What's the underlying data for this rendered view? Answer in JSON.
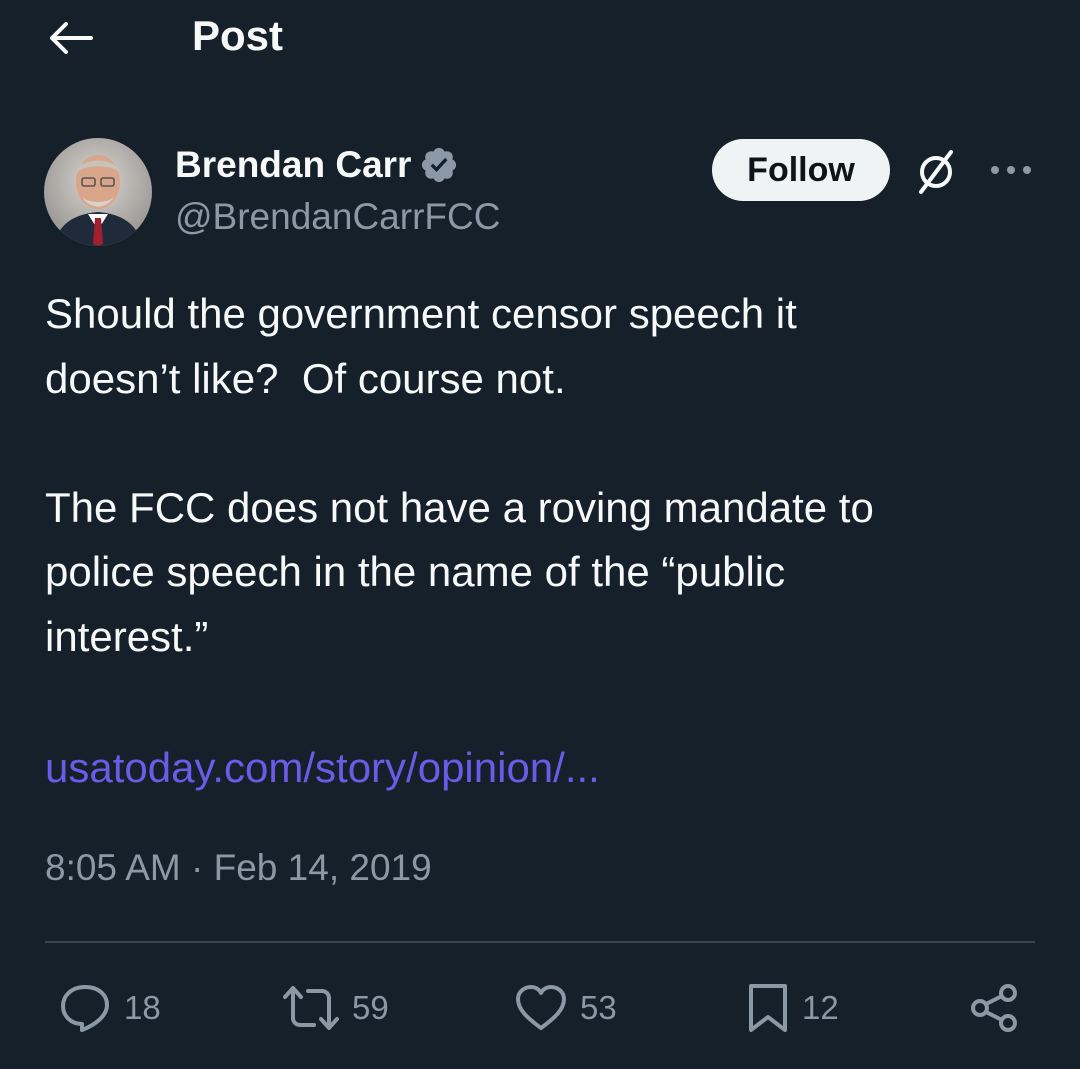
{
  "header": {
    "title": "Post",
    "back_icon": "arrow-left-icon"
  },
  "author": {
    "name": "Brendan Carr",
    "handle": "@BrendanCarrFCC",
    "verified": true,
    "verified_color": "#8b98a5"
  },
  "actions_top": {
    "follow_label": "Follow",
    "grok_icon": "grok-icon",
    "more_icon": "more-horizontal-icon"
  },
  "post": {
    "paragraphs": [
      "Should the government censor speech it\ndoesn’t like?  Of course not.",
      "The FCC does not have a roving mandate to\npolice speech in the name of the “public\ninterest.”"
    ],
    "link_text": "usatoday.com/story/opinion/...",
    "link_color": "#6b5ce7",
    "timestamp": "8:05 AM · Feb 14, 2019"
  },
  "engagement": {
    "replies": "18",
    "reposts": "59",
    "likes": "53",
    "bookmarks": "12"
  },
  "colors": {
    "background": "#15202b",
    "text": "#f7f9f9",
    "secondary": "#8b98a5",
    "divider": "#38444d"
  }
}
